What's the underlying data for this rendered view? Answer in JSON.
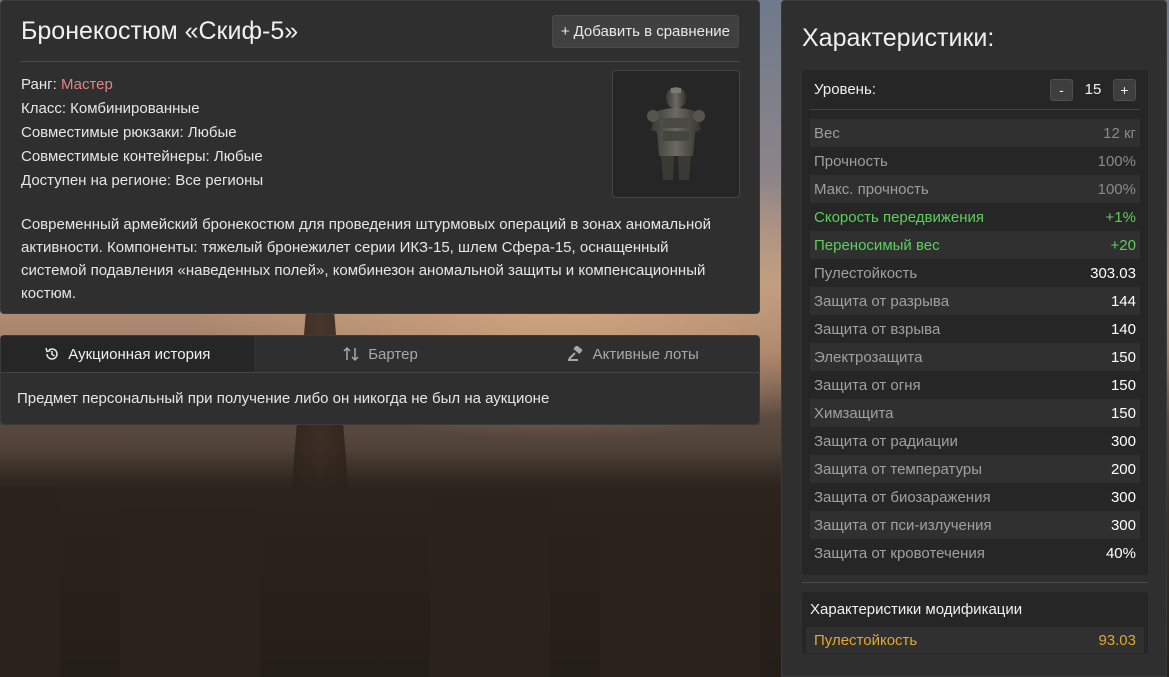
{
  "item": {
    "title": "Бронекостюм «Скиф-5»",
    "compare_label": "Добавить в сравнение",
    "meta": {
      "rank_label": "Ранг:",
      "rank_value": "Мастер",
      "class_line": "Класс: Комбинированные",
      "backpacks_line": "Совместимые рюкзаки: Любые",
      "containers_line": "Совместимые контейнеры: Любые",
      "region_line": "Доступен на регионе: Все регионы"
    },
    "description": "Современный армейский бронекостюм для проведения штурмовых операций в зонах аномальной активности. Компоненты: тяжелый бронежилет серии ИКЗ-15, шлем Сфера-15, оснащенный системой подавления «наведенных полей», комбинезон аномальной защиты и компенсационный костюм."
  },
  "tabs": [
    {
      "label": "Аукционная история",
      "icon": "history-icon",
      "active": true
    },
    {
      "label": "Бартер",
      "icon": "swap-arrows-icon",
      "active": false
    },
    {
      "label": "Активные лоты",
      "icon": "gavel-icon",
      "active": false
    }
  ],
  "tab_content": "Предмет персональный при получение либо он никогда не был на аукционе",
  "stats": {
    "title": "Характеристики:",
    "level_label": "Уровень:",
    "level_value": "15",
    "minus_label": "-",
    "plus_label": "+",
    "rows": [
      {
        "name": "Вес",
        "value": "12 кг",
        "style": "dim"
      },
      {
        "name": "Прочность",
        "value": "100%",
        "style": "dim"
      },
      {
        "name": "Макс. прочность",
        "value": "100%",
        "style": "dim"
      },
      {
        "name": "Скорость передвижения",
        "value": "+1%",
        "style": "green"
      },
      {
        "name": "Переносимый вес",
        "value": "+20",
        "style": "green"
      },
      {
        "name": "Пулестойкость",
        "value": "303.03",
        "style": "bright"
      },
      {
        "name": "Защита от разрыва",
        "value": "144",
        "style": "bright"
      },
      {
        "name": "Защита от взрыва",
        "value": "140",
        "style": "bright"
      },
      {
        "name": "Электрозащита",
        "value": "150",
        "style": "bright"
      },
      {
        "name": "Защита от огня",
        "value": "150",
        "style": "bright"
      },
      {
        "name": "Химзащита",
        "value": "150",
        "style": "bright"
      },
      {
        "name": "Защита от радиации",
        "value": "300",
        "style": "bright"
      },
      {
        "name": "Защита от температуры",
        "value": "200",
        "style": "bright"
      },
      {
        "name": "Защита от биозаражения",
        "value": "300",
        "style": "bright"
      },
      {
        "name": "Защита от пси-излучения",
        "value": "300",
        "style": "bright"
      },
      {
        "name": "Защита от кровотечения",
        "value": "40%",
        "style": "bright"
      }
    ],
    "mod_title": "Характеристики модификации",
    "mod_rows": [
      {
        "name": "Пулестойкость",
        "value": "93.03"
      }
    ]
  },
  "colors": {
    "rank": "#e08585",
    "positive": "#5ccf5c",
    "mod": "#e0a82e"
  }
}
